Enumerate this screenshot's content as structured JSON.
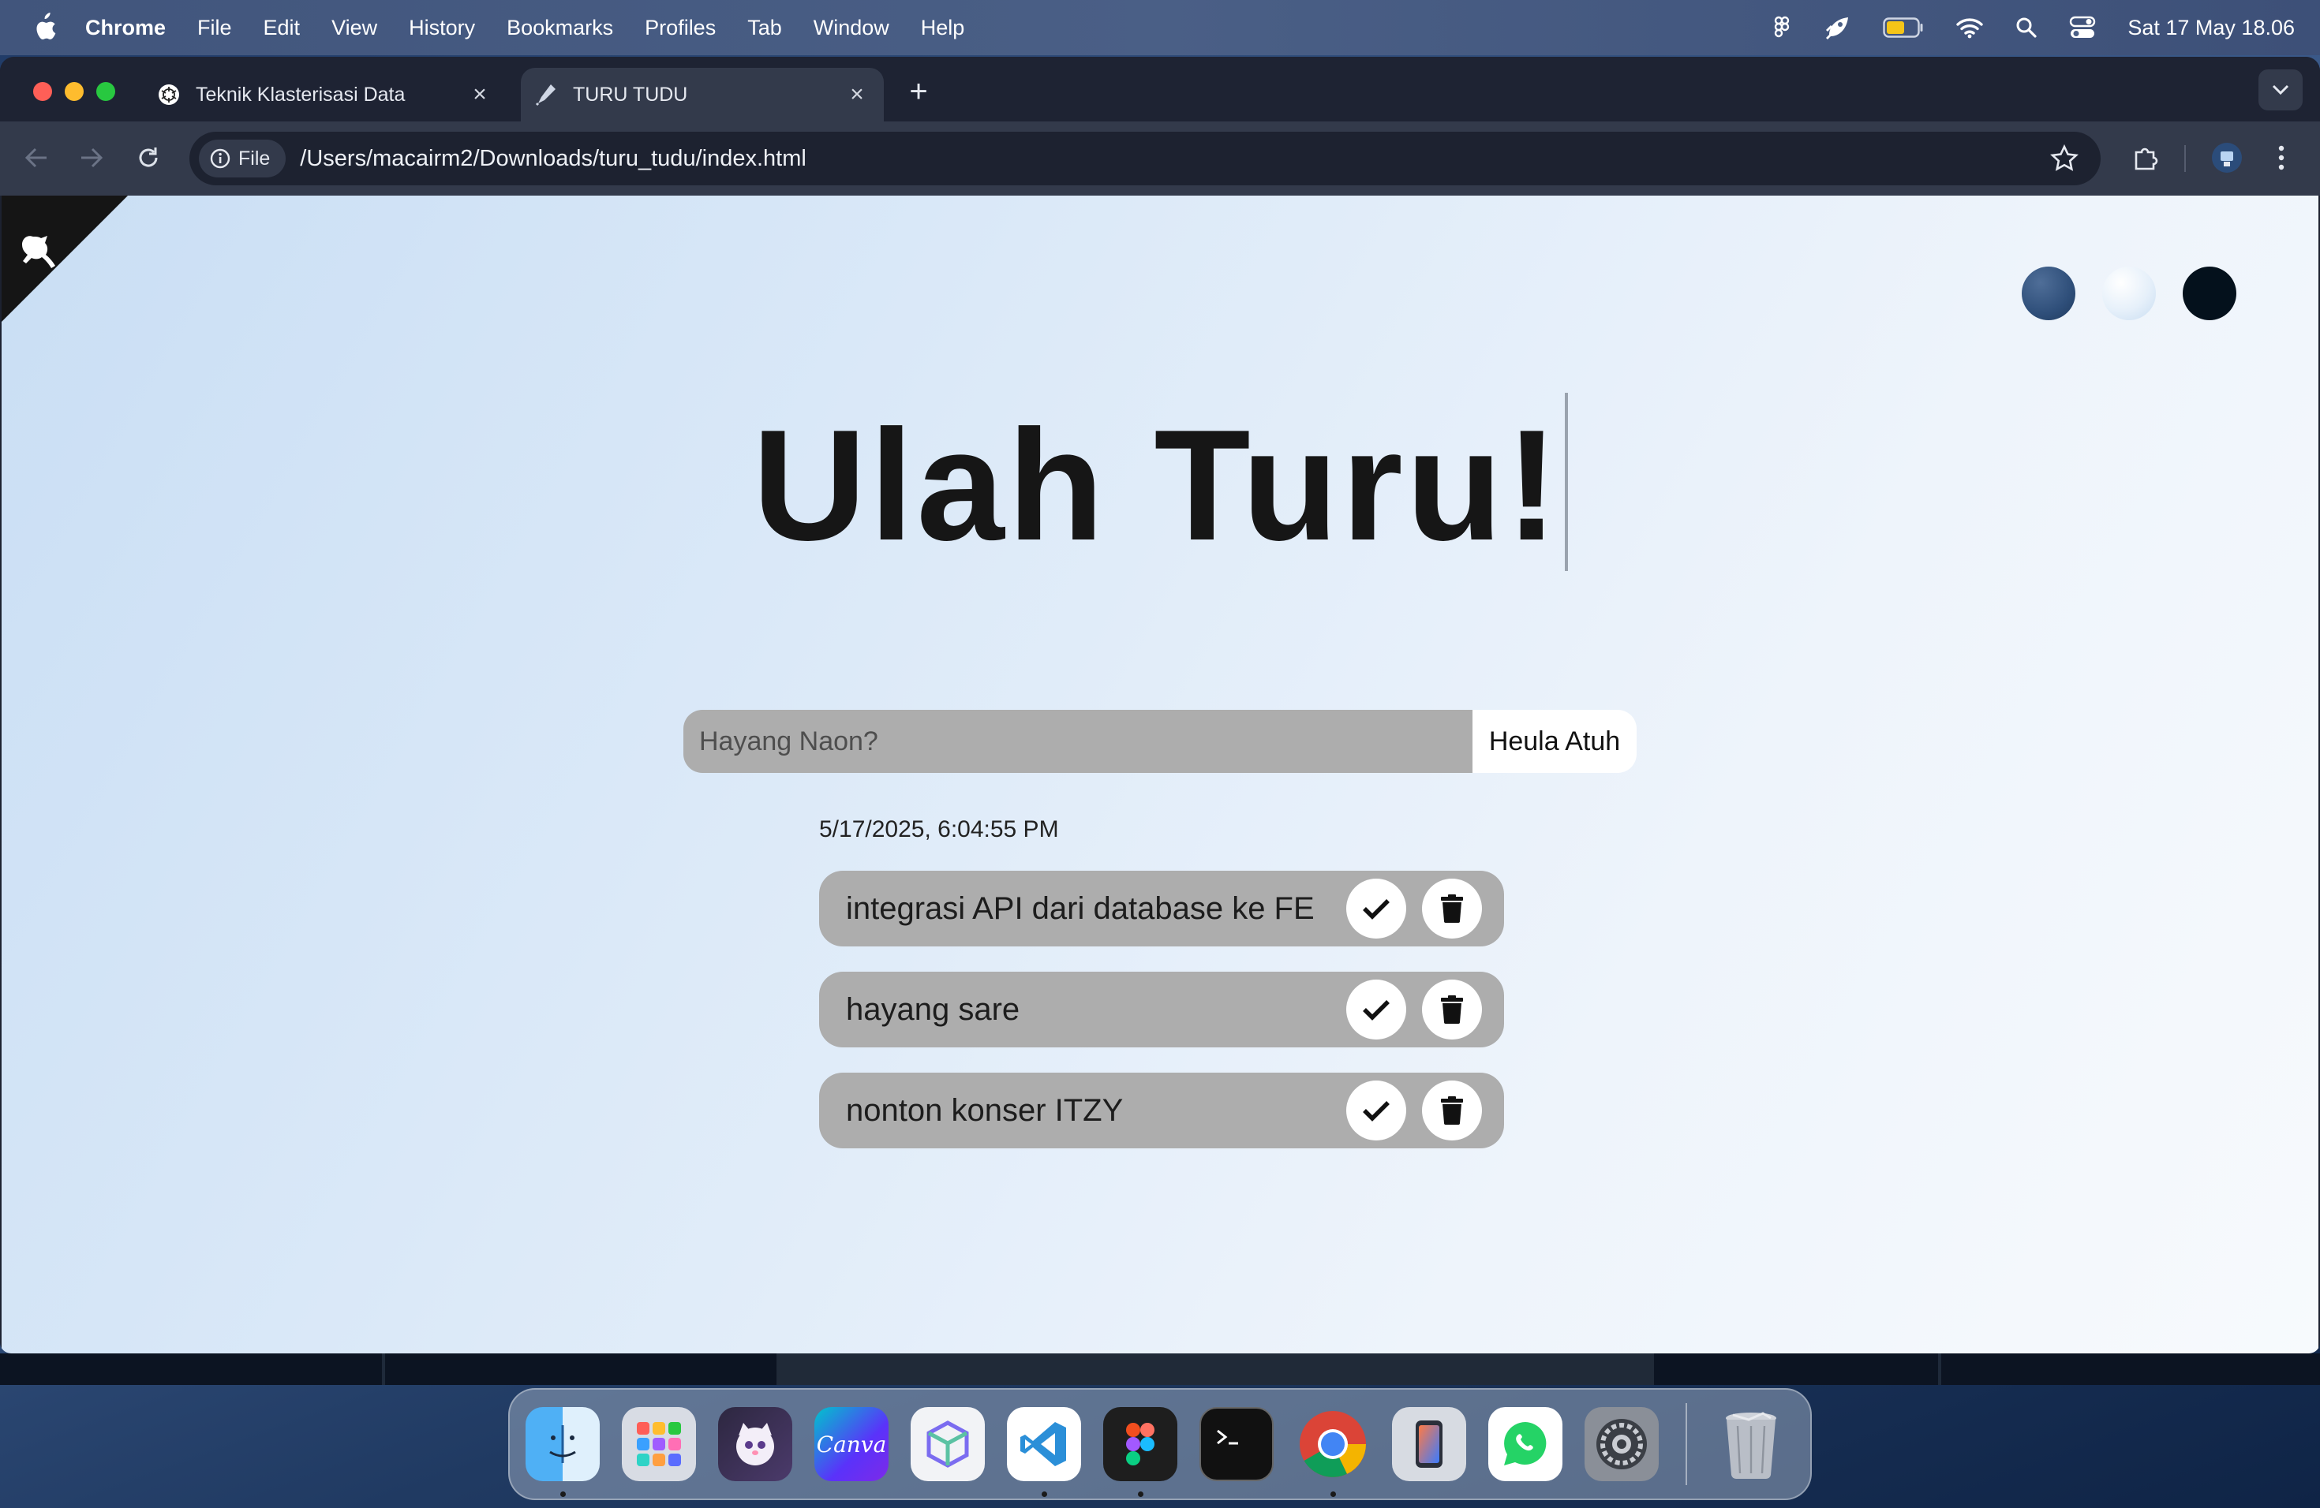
{
  "menubar": {
    "app_name": "Chrome",
    "items": [
      "File",
      "Edit",
      "View",
      "History",
      "Bookmarks",
      "Profiles",
      "Tab",
      "Window",
      "Help"
    ],
    "clock": "Sat 17 May  18.06"
  },
  "browser": {
    "tabs": [
      {
        "title": "Teknik Klasterisasi Data",
        "favicon": "openai-icon",
        "active": false
      },
      {
        "title": "TURU TUDU",
        "favicon": "tudu-favicon",
        "active": true
      }
    ],
    "site_chip": "File",
    "url": "/Users/macairm2/Downloads/turu_tudu/index.html"
  },
  "app": {
    "heading": "Ulah Turu!",
    "input_placeholder": "Hayang Naon?",
    "add_button": "Heula Atuh",
    "timestamp": "5/17/2025, 6:04:55 PM",
    "theme_colors": [
      "#2f4f7a",
      "#e6f0fa",
      "#04111c"
    ],
    "todos": [
      {
        "text": "integrasi API dari database ke FE"
      },
      {
        "text": "hayang sare"
      },
      {
        "text": "nonton konser ITZY"
      }
    ]
  },
  "dock": {
    "apps": [
      "Finder",
      "Launchpad",
      "Pet",
      "Canva",
      "Package",
      "VS Code",
      "Figma",
      "Terminal",
      "Chrome",
      "iPhone Mirroring",
      "WhatsApp",
      "System Settings",
      "Trash"
    ],
    "canva_label": "Canva"
  }
}
